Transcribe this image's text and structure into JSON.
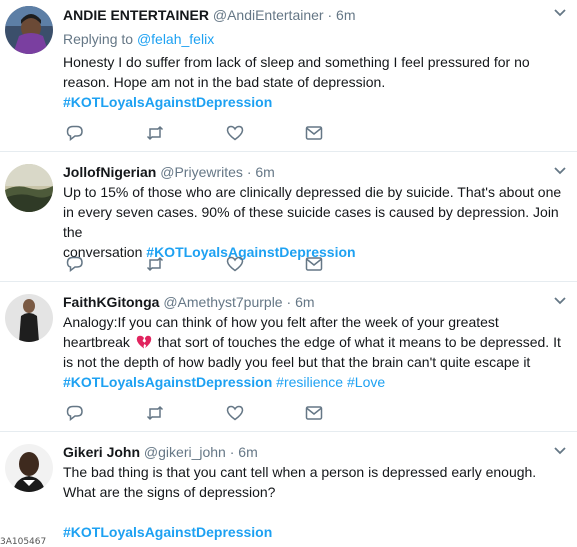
{
  "tweets": [
    {
      "name": "ANDIE ENTERTAINER",
      "handle": "@AndiEntertainer",
      "time": "6m",
      "replying_prefix": "Replying to ",
      "replying_to": "@felah_felix",
      "text_line1": "Honesty I do suffer from lack of sleep and something I feel pressured for no",
      "text_line2": "reason. Hope am not in the bad state of depression.",
      "hashtag": "#KOTLoyalsAgainstDepression"
    },
    {
      "name": "JollofNigerian",
      "handle": "@Priyewrites",
      "time": "6m",
      "text_line1": "Up to 15% of those who are clinically depressed die by suicide. That's about one",
      "text_line2": "in every seven cases. 90% of these suicide cases is caused by depression. Join the",
      "text_line3": "conversation",
      "hashtag": "#KOTLoyalsAgainstDepression"
    },
    {
      "name": "FaithKGitonga",
      "handle": "@Amethyst7purple",
      "time": "6m",
      "text_line1": "Analogy:If you can think of how you felt after the week of your greatest",
      "text_line2a": "heartbreak",
      "text_line2b": "that sort of touches the edge of what it means to be depressed. It",
      "text_line3": "is not the depth of how badly you feel but that the brain can't quite escape it",
      "hashtag": "#KOTLoyalsAgainstDepression",
      "hashtag2": "#resilience",
      "hashtag3": "#Love"
    },
    {
      "name": "Gikeri John",
      "handle": "@gikeri_john",
      "time": "6m",
      "text_line1": "The bad thing is that you cant tell when a person is depressed early enough.",
      "text_line2": "What are the signs of depression?",
      "hashtag": "#KOTLoyalsAgainstDepression"
    }
  ],
  "separator": "·",
  "footer_fragment": "3A105467",
  "icons": [
    "reply-icon",
    "retweet-icon",
    "like-icon",
    "message-icon",
    "caret-down-icon",
    "broken-heart-icon"
  ],
  "colors": {
    "link": "#1da1f2",
    "muted": "#657786",
    "text": "#14171a",
    "icon": "#657786",
    "broken_heart": "#e0245e"
  }
}
